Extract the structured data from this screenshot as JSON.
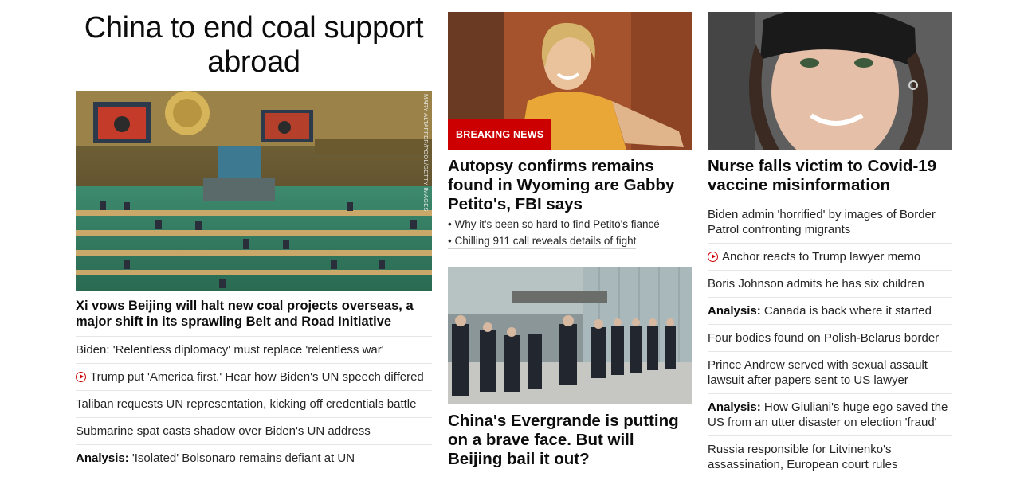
{
  "lead_story": {
    "title": "China to end coal support abroad",
    "image_credit": "MARY ALTAFFER/POOL/GETTY IMAGES",
    "headline": "Xi vows Beijing will halt new coal projects overseas, a major shift in its sprawling Belt and Road Initiative",
    "links": [
      {
        "kicker": "",
        "text": "Biden: 'Relentless diplomacy' must replace 'relentless war'",
        "video": false
      },
      {
        "kicker": "",
        "text": "Trump put 'America first.' Hear how Biden's UN speech differed",
        "video": true
      },
      {
        "kicker": "",
        "text": "Taliban requests UN representation, kicking off credentials battle",
        "video": false
      },
      {
        "kicker": "",
        "text": "Submarine spat casts shadow over Biden's UN address",
        "video": false
      },
      {
        "kicker": "Analysis:",
        "text": " 'Isolated' Bolsonaro remains defiant at UN",
        "video": false
      }
    ]
  },
  "middle": {
    "story1": {
      "badge": "BREAKING NEWS",
      "headline": "Autopsy confirms remains found in Wyoming are Gabby Petito's, FBI says",
      "bullets": [
        "• Why it's been so hard to find Petito's fiancé",
        "• Chilling 911 call reveals details of fight"
      ]
    },
    "story2": {
      "headline": "China's Evergrande is putting on a brave face. But will Beijing bail it out?"
    }
  },
  "right": {
    "headline": "Nurse falls victim to Covid-19 vaccine misinformation",
    "links": [
      {
        "kicker": "",
        "text": "Biden admin 'horrified' by images of Border Patrol confronting migrants",
        "video": false
      },
      {
        "kicker": "",
        "text": "Anchor reacts to Trump lawyer memo",
        "video": true
      },
      {
        "kicker": "",
        "text": "Boris Johnson admits he has six children",
        "video": false
      },
      {
        "kicker": "Analysis:",
        "text": " Canada is back where it started",
        "video": false
      },
      {
        "kicker": "",
        "text": "Four bodies found on Polish-Belarus border",
        "video": false
      },
      {
        "kicker": "",
        "text": "Prince Andrew served with sexual assault lawsuit after papers sent to US lawyer",
        "video": false
      },
      {
        "kicker": "Analysis:",
        "text": " How Giuliani's huge ego saved the US from an utter disaster on election 'fraud'",
        "video": false
      },
      {
        "kicker": "",
        "text": "Russia responsible for Litvinenko's assassination, European court rules",
        "video": false
      }
    ]
  },
  "colors": {
    "breaking": "#cc0000",
    "video_icon": "#cc0000",
    "divider": "#e6e6e6"
  }
}
